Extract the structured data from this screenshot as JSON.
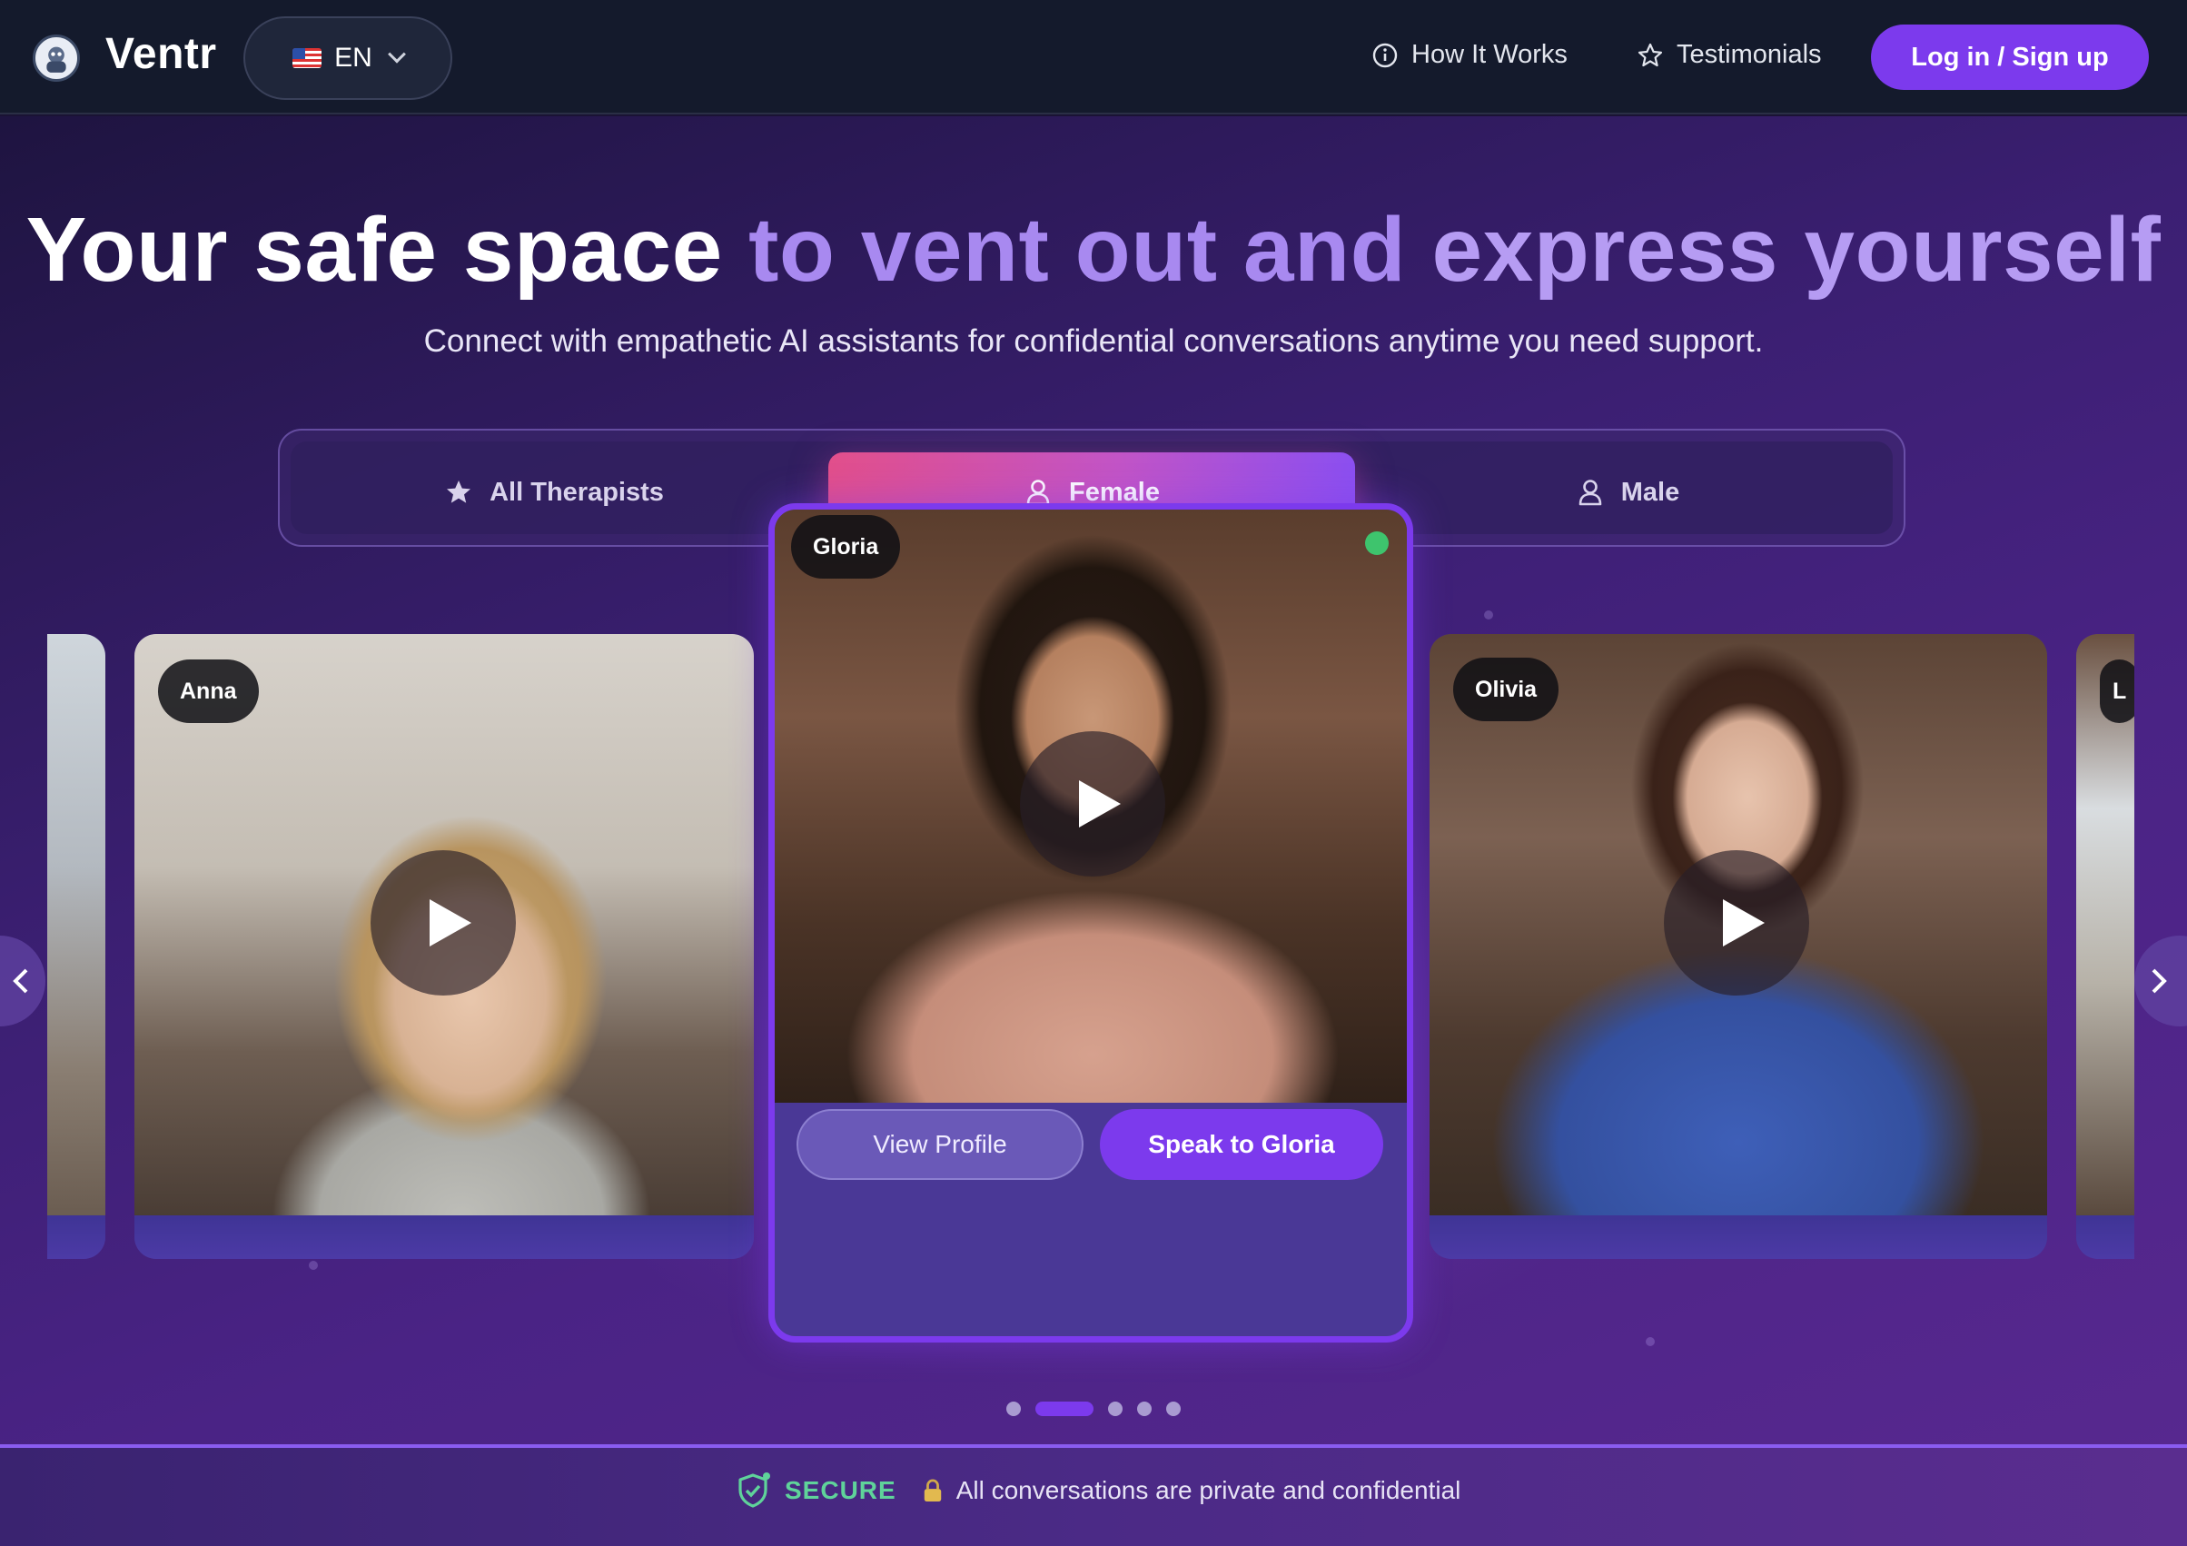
{
  "nav": {
    "brand": "Ventr",
    "language": "EN",
    "links": [
      {
        "label": "How It Works",
        "icon": "info-icon"
      },
      {
        "label": "Testimonials",
        "icon": "star-outline-icon"
      }
    ],
    "login_label": "Log in / Sign up"
  },
  "hero": {
    "headline_part1": "Your safe space",
    "headline_part2": "to vent out and",
    "headline_part3": "express yourself",
    "subheadline": "Connect with empathetic AI assistants for confidential conversations anytime you need support."
  },
  "filters": {
    "tabs": [
      {
        "label": "All Therapists",
        "icon": "star-icon",
        "active": false
      },
      {
        "label": "Female",
        "icon": "user-icon",
        "active": true
      },
      {
        "label": "Male",
        "icon": "user-icon",
        "active": false
      }
    ]
  },
  "carousel": {
    "cards": [
      {
        "name": "Anna"
      },
      {
        "name": "Gloria",
        "featured": true,
        "online": true
      },
      {
        "name": "Olivia"
      },
      {
        "name": "L"
      }
    ],
    "view_profile_label": "View Profile",
    "speak_label": "Speak to Gloria",
    "page_count": 5,
    "active_page": 2
  },
  "secure": {
    "label": "SECURE",
    "message": "All conversations are private and confidential"
  },
  "colors": {
    "accent": "#7c3aed",
    "tab_gradient_start": "#e24f8b",
    "secure_green": "#5fd39a",
    "nav_bg": "#141a2c"
  }
}
